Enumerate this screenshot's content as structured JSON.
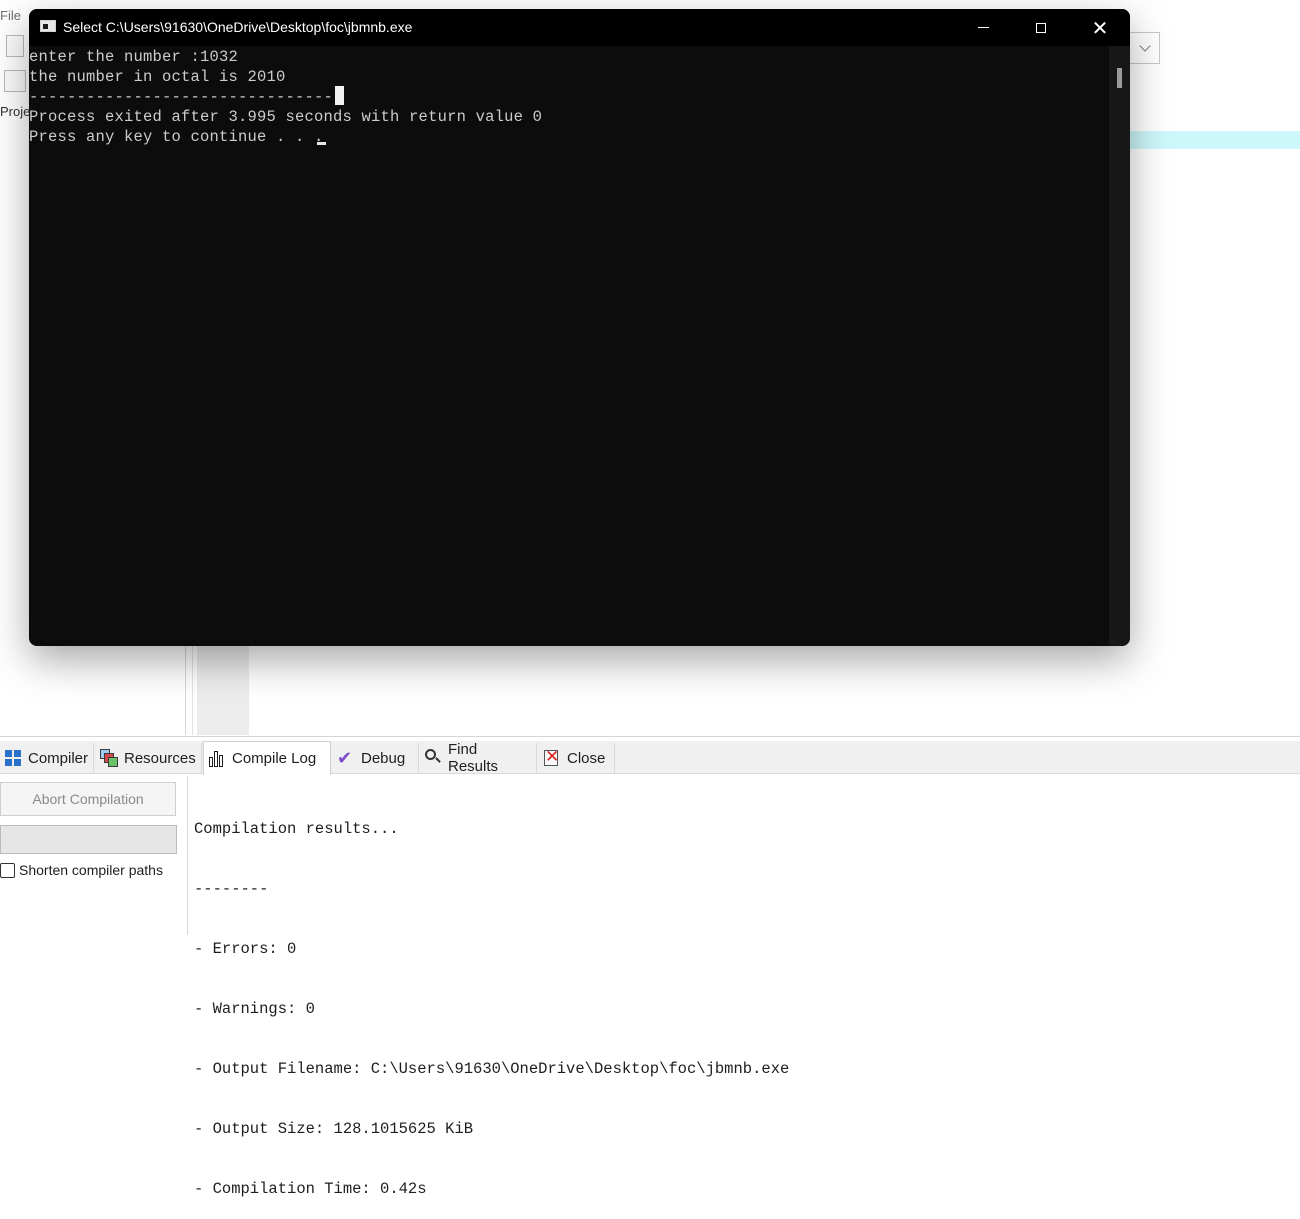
{
  "ide": {
    "menu_file": "File",
    "project_tab": "Proje"
  },
  "bottom_tabs": [
    {
      "label": "Compiler",
      "icon": "compiler-grid-icon"
    },
    {
      "label": "Resources",
      "icon": "resources-icon"
    },
    {
      "label": "Compile Log",
      "icon": "bar-chart-icon"
    },
    {
      "label": "Debug",
      "icon": "check-icon"
    },
    {
      "label": "Find Results",
      "icon": "find-icon"
    },
    {
      "label": "Close",
      "icon": "close-doc-icon"
    }
  ],
  "bottom_left": {
    "abort_label": "Abort Compilation",
    "shorten_label": "Shorten compiler paths"
  },
  "compile_log": {
    "lines": [
      "Compilation results...",
      "--------",
      "- Errors: 0",
      "- Warnings: 0",
      "- Output Filename: C:\\Users\\91630\\OneDrive\\Desktop\\foc\\jbmnb.exe",
      "- Output Size: 128.1015625 KiB",
      "- Compilation Time: 0.42s"
    ]
  },
  "console": {
    "title": "Select C:\\Users\\91630\\OneDrive\\Desktop\\foc\\jbmnb.exe",
    "lines": [
      "enter the number :1032",
      "the number in octal is 2010",
      "--------------------------------",
      "Process exited after 3.995 seconds with return value 0",
      "Press any key to continue . . . "
    ],
    "background_color": "#0c0c0c",
    "text_color": "#cccccc"
  }
}
